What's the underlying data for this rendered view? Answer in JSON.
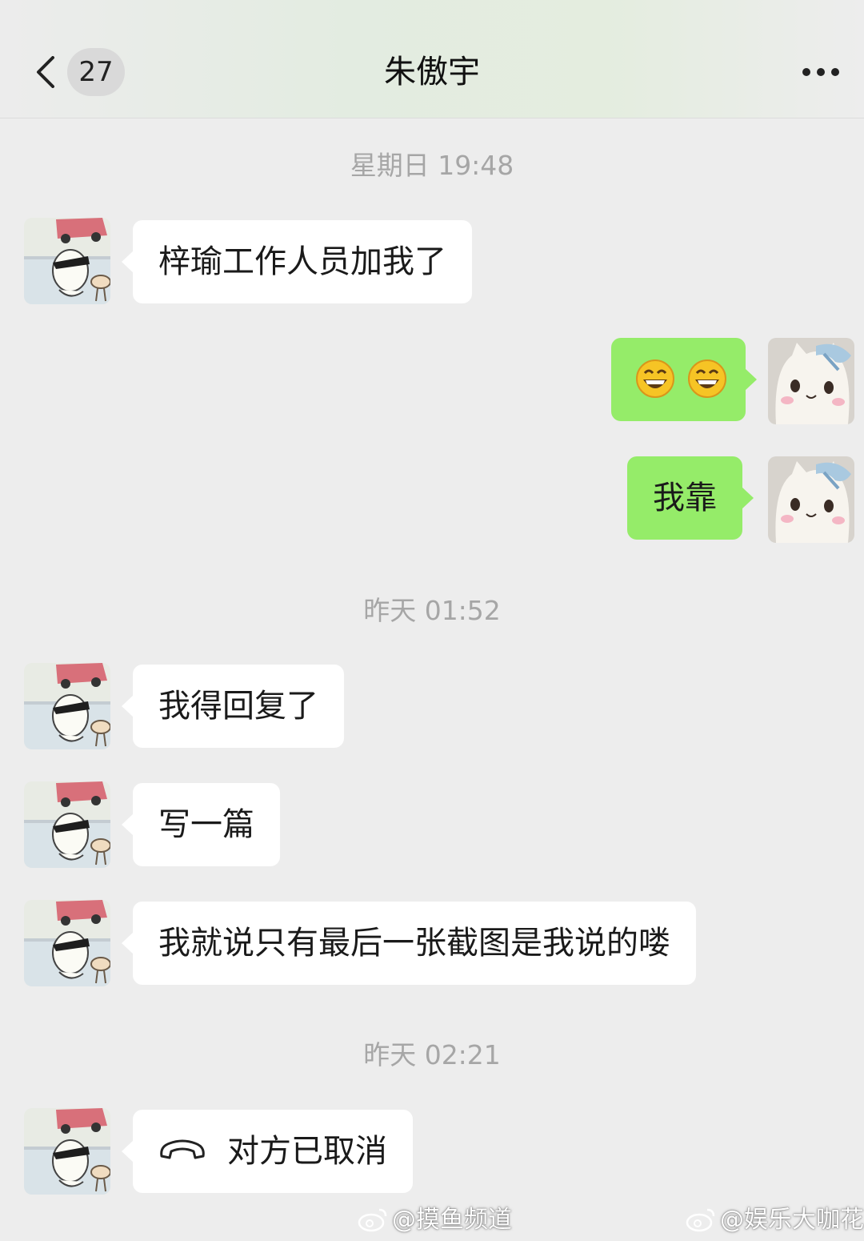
{
  "header": {
    "unread_count": "27",
    "title": "朱傲宇"
  },
  "messages": [
    {
      "type": "timestamp",
      "text": "星期日 19:48"
    },
    {
      "type": "text",
      "side": "left",
      "text": "梓瑜工作人员加我了"
    },
    {
      "type": "emoji",
      "side": "right",
      "emoji": [
        "grin-emoji",
        "grin-emoji"
      ]
    },
    {
      "type": "text",
      "side": "right",
      "text": "我靠"
    },
    {
      "type": "timestamp",
      "text": "昨天 01:52"
    },
    {
      "type": "text",
      "side": "left",
      "text": "我得回复了"
    },
    {
      "type": "text",
      "side": "left",
      "text": "写一篇"
    },
    {
      "type": "text",
      "side": "left",
      "text": "我就说只有最后一张截图是我说的喽"
    },
    {
      "type": "timestamp",
      "text": "昨天 02:21"
    },
    {
      "type": "call",
      "side": "left",
      "icon": "phone-hangup-icon",
      "text": "对方已取消"
    }
  ],
  "watermarks": [
    {
      "text": "@摸鱼频道",
      "icon": "weibo-icon"
    },
    {
      "text": "@娱乐大咖花",
      "icon": "weibo-icon"
    }
  ],
  "colors": {
    "background": "#ededed",
    "bubble_self": "#95ec69",
    "bubble_other": "#ffffff",
    "timestamp": "#a6a6a6"
  }
}
